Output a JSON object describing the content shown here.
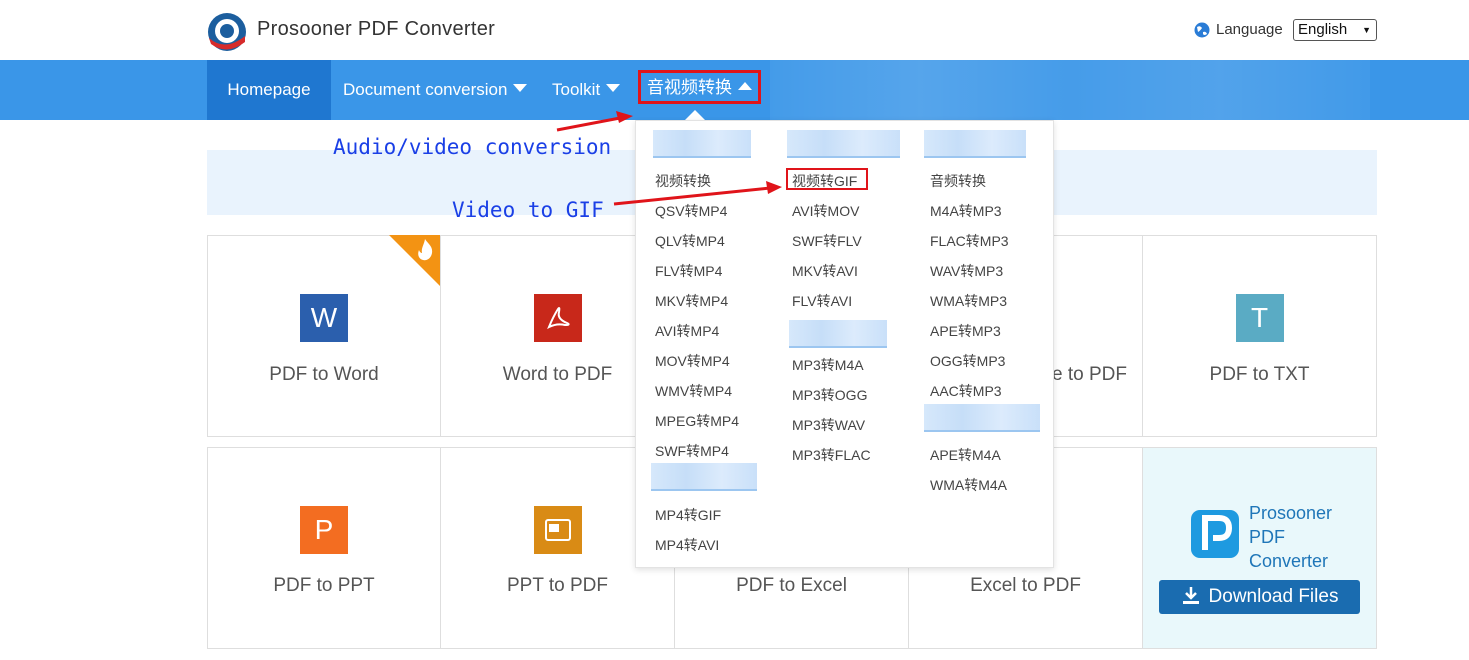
{
  "header": {
    "app_title": "Prosooner PDF Converter",
    "language_label": "Language",
    "language_value": "English"
  },
  "nav": {
    "homepage": "Homepage",
    "document_conversion": "Document conversion",
    "toolkit": "Toolkit",
    "audio_video": "音视频转换"
  },
  "dropdown": {
    "col1": [
      "视频转换",
      "QSV转MP4",
      "QLV转MP4",
      "FLV转MP4",
      "MKV转MP4",
      "AVI转MP4",
      "MOV转MP4",
      "WMV转MP4",
      "MPEG转MP4",
      "SWF转MP4"
    ],
    "col1b": [
      "MP4转GIF",
      "MP4转AVI"
    ],
    "col2": [
      "视频转GIF",
      "AVI转MOV",
      "SWF转FLV",
      "MKV转AVI",
      "FLV转AVI"
    ],
    "col2b": [
      "MP3转M4A",
      "MP3转OGG",
      "MP3转WAV",
      "MP3转FLAC"
    ],
    "col3": [
      "音频转换",
      "M4A转MP3",
      "FLAC转MP3",
      "WAV转MP3",
      "WMA转MP3",
      "APE转MP3",
      "OGG转MP3",
      "AAC转MP3"
    ],
    "col3b": [
      "APE转M4A",
      "WMA转M4A"
    ]
  },
  "cards": {
    "pdf_to_word": "PDF to Word",
    "word_to_pdf": "Word to PDF",
    "image_to_pdf_partial": "e to PDF",
    "pdf_to_txt": "PDF to TXT",
    "pdf_to_ppt": "PDF to PPT",
    "ppt_to_pdf": "PPT to PDF",
    "pdf_to_excel": "PDF to Excel",
    "excel_to_pdf": "Excel to PDF"
  },
  "download": {
    "name_line1": "Prosooner",
    "name_line2": "PDF",
    "name_line3": "Converter",
    "button": "Download Files"
  },
  "annotations": {
    "audio_video": "Audio/video conversion",
    "video_to_gif": "Video to GIF"
  },
  "colors": {
    "nav_bg": "#3a96e8",
    "nav_active": "#1f77d0",
    "highlight_red": "#e0141a",
    "annotation_blue": "#1a3fe6",
    "word_blue": "#2b5fad",
    "pdf_red": "#c8281a",
    "txt_teal": "#5aabc4",
    "ppt_orange": "#f36d21",
    "pptpdf_orange": "#d98b15",
    "download_btn": "#1a6cb0"
  }
}
